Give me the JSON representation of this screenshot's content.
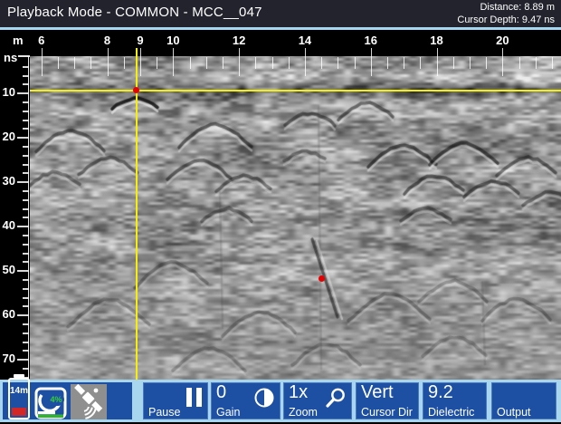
{
  "titlebar": {
    "title": "Playback Mode - COMMON - MCC__047",
    "distance": "Distance: 8.89 m",
    "cursor_depth": "Cursor Depth: 9.47 ns"
  },
  "rulers": {
    "top": {
      "unit": "m",
      "labels": [
        {
          "text": "6",
          "value": 6
        },
        {
          "text": "8",
          "value": 8
        },
        {
          "text": "9",
          "value": 9
        },
        {
          "text": "10",
          "value": 10
        },
        {
          "text": "12",
          "value": 12
        },
        {
          "text": "14",
          "value": 14
        },
        {
          "text": "16",
          "value": 16
        },
        {
          "text": "18",
          "value": 18
        },
        {
          "text": "20",
          "value": 20
        }
      ],
      "minor_step": 0.5,
      "range": [
        6,
        21.5
      ]
    },
    "left": {
      "unit": "ns",
      "labels": [
        {
          "text": "10",
          "value": 10
        },
        {
          "text": "20",
          "value": 20
        },
        {
          "text": "30",
          "value": 30
        },
        {
          "text": "40",
          "value": 40
        },
        {
          "text": "50",
          "value": 50
        },
        {
          "text": "60",
          "value": 60
        },
        {
          "text": "70",
          "value": 70
        }
      ],
      "minor_step": 2,
      "range": [
        4,
        74
      ]
    }
  },
  "cursor": {
    "distance_m": 8.89,
    "depth_ns": 9.47
  },
  "markers": [
    {
      "m": 8.89,
      "ns": 9.47
    },
    {
      "m": 14.5,
      "ns": 51.8
    }
  ],
  "status_icons": {
    "battery": {
      "time_remaining": "14m"
    },
    "storage": {
      "percent_used": "4%"
    },
    "satellite": {
      "name": "gps-satellite"
    }
  },
  "toolbar": {
    "buttons": [
      {
        "id": "pause",
        "value": "",
        "label": "Pause",
        "icon": "pause-icon"
      },
      {
        "id": "gain",
        "value": "0",
        "label": "Gain",
        "icon": "contrast-icon"
      },
      {
        "id": "zoom",
        "value": "1x",
        "label": "Zoom",
        "icon": "magnifier-icon"
      },
      {
        "id": "cursor-dir",
        "value": "Vert",
        "label": "Cursor Dir",
        "icon": ""
      },
      {
        "id": "dielectric",
        "value": "9.2",
        "label": "Dielectric",
        "icon": ""
      },
      {
        "id": "output",
        "value": "",
        "label": "Output",
        "icon": ""
      }
    ]
  },
  "colors": {
    "button_blue": "#1d4fa3",
    "toolbar_bg": "#a9d6ef",
    "cursor_yellow": "#f6ef0a",
    "marker_red": "#e60000",
    "titlebar_bg": "#23232e"
  }
}
